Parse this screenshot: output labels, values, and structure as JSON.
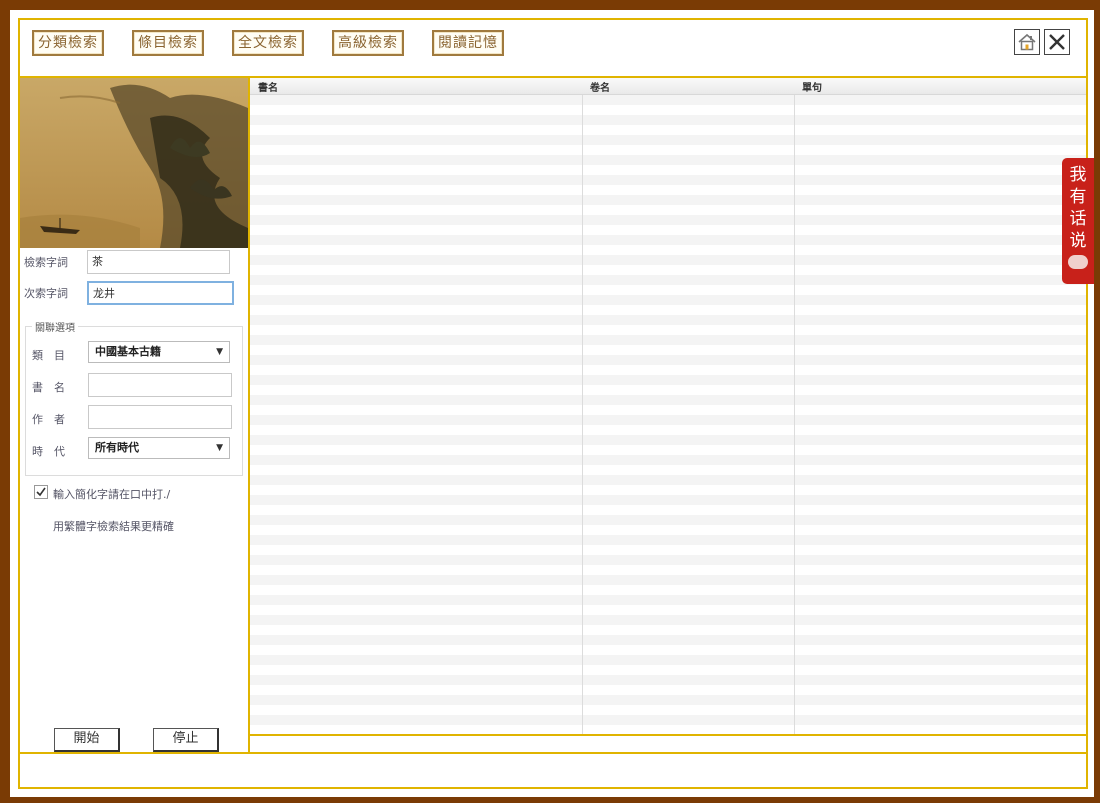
{
  "toolbar": {
    "tabs": [
      "分類檢索",
      "條目檢索",
      "全文檢索",
      "高級檢索",
      "閱讀記憶"
    ]
  },
  "search": {
    "main_label": "檢索字詞",
    "main_value": "茶",
    "sub_label": "次索字詞",
    "sub_value": "龙井"
  },
  "options": {
    "legend": "關聯選項",
    "category_label": "類　目",
    "category_value": "中國基本古籍",
    "book_label": "書　名",
    "book_value": "",
    "author_label": "作　者",
    "author_value": "",
    "era_label": "時　代",
    "era_value": "所有時代"
  },
  "hint": {
    "line1": "輸入簡化字請在口中打./",
    "line2": "用繁體字檢索結果更精確",
    "checked": true
  },
  "actions": {
    "start": "開始",
    "stop": "停止"
  },
  "results": {
    "columns": [
      "書名",
      "卷名",
      "單句"
    ]
  },
  "side_badge": {
    "text": "我有话说"
  }
}
